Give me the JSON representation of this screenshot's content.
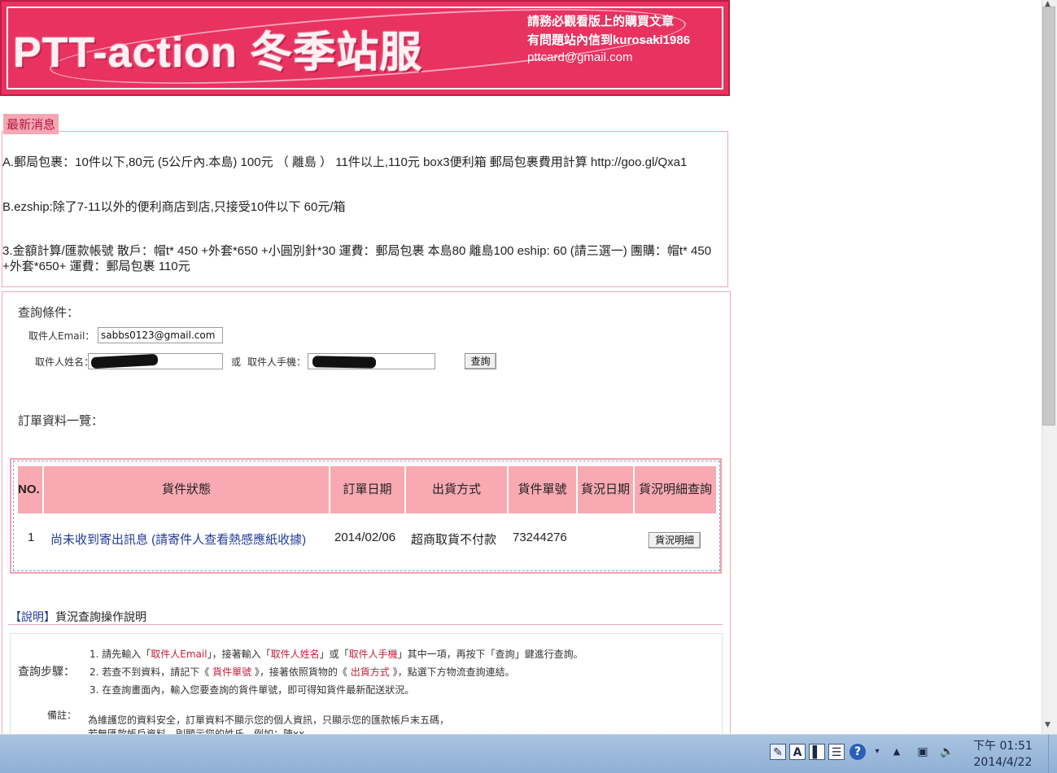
{
  "banner": {
    "title": "PTT-action  冬季站服",
    "line1": "請務必觀看版上的購買文章",
    "line2": "有問題站內信到kurosaki1986",
    "line3": "pttcard@gmail.com"
  },
  "news": {
    "tag": "最新消息",
    "items": [
      "A.郵局包裹：10件以下,80元 (5公斤內.本島) 100元 （ 離島 ） 11件以上,110元 box3便利箱 郵局包裹費用計算 http://goo.gl/Qxa1",
      "B.ezship:除了7-11以外的便利商店到店,只接受10件以下 60元/箱",
      "3.金額計算/匯款帳號 散戶：帽t* 450 +外套*650 +小圓別針*30 運費：郵局包裹 本島80 離島100 eship: 60 (請三選一) 團購：帽t* 450 +外套*650+ 運費：郵局包裹 110元"
    ]
  },
  "query": {
    "heading": "查詢條件：",
    "email_label": "取件人Email：",
    "email_value": "sabbs0123@gmail.com",
    "name_label": "取件人姓名：",
    "or_text": "或",
    "phone_label": "取件人手機：",
    "search_button": "查詢"
  },
  "orders": {
    "heading": "訂單資料一覽：",
    "columns": [
      "NO.",
      "貨件狀態",
      "訂單日期",
      "出貨方式",
      "貨件單號",
      "貨況日期",
      "貨況明細查詢"
    ],
    "rows": [
      {
        "no": "1",
        "status": "尚未收到寄出訊息 (請寄件人查看熱感應紙收據)",
        "order_date": "2014/02/06",
        "shipping": "超商取貨不付款",
        "tracking": "73244276",
        "status_date": "",
        "detail_button": "貨況明細"
      }
    ]
  },
  "instructions": {
    "tag": "【說明】",
    "title": "貨況查詢操作說明",
    "steps_label": "查詢步驟：",
    "step1": {
      "a": "1. 請先輸入「",
      "b": "取件人Email",
      "c": "」，接著輸入「",
      "d": "取件人姓名",
      "e": "」或「",
      "f": "取件人手機",
      "g": "」其中一項，再按下「查詢」鍵進行查詢。"
    },
    "step2": {
      "a": "2. 若查不到資料，請記下《 ",
      "b": "貨件單號",
      "c": " 》，接著依照貨物的《 ",
      "d": "出貨方式",
      "e": " 》，點選下方物流查詢連結。"
    },
    "step3": "3. 在查詢畫面內，輸入您要查詢的貨件單號，即可得知貨件最新配送狀況。",
    "note_label": "備註：",
    "note1": "為維護您的資料安全，訂單資料不顯示您的個人資訊，只顯示您的匯款帳戶末五碼，",
    "note2": "若無匯款帳戶資料，則顯示您的姓氏，例如：陳xx。"
  },
  "taskbar": {
    "time": "下午 01:51",
    "date": "2014/4/22"
  },
  "colors": {
    "banner": "#e8325f",
    "news_tag_bg": "#f4a7b2",
    "table_header": "#f9a9b1",
    "link": "#1f3a9a",
    "highlight": "#c41e3a"
  }
}
